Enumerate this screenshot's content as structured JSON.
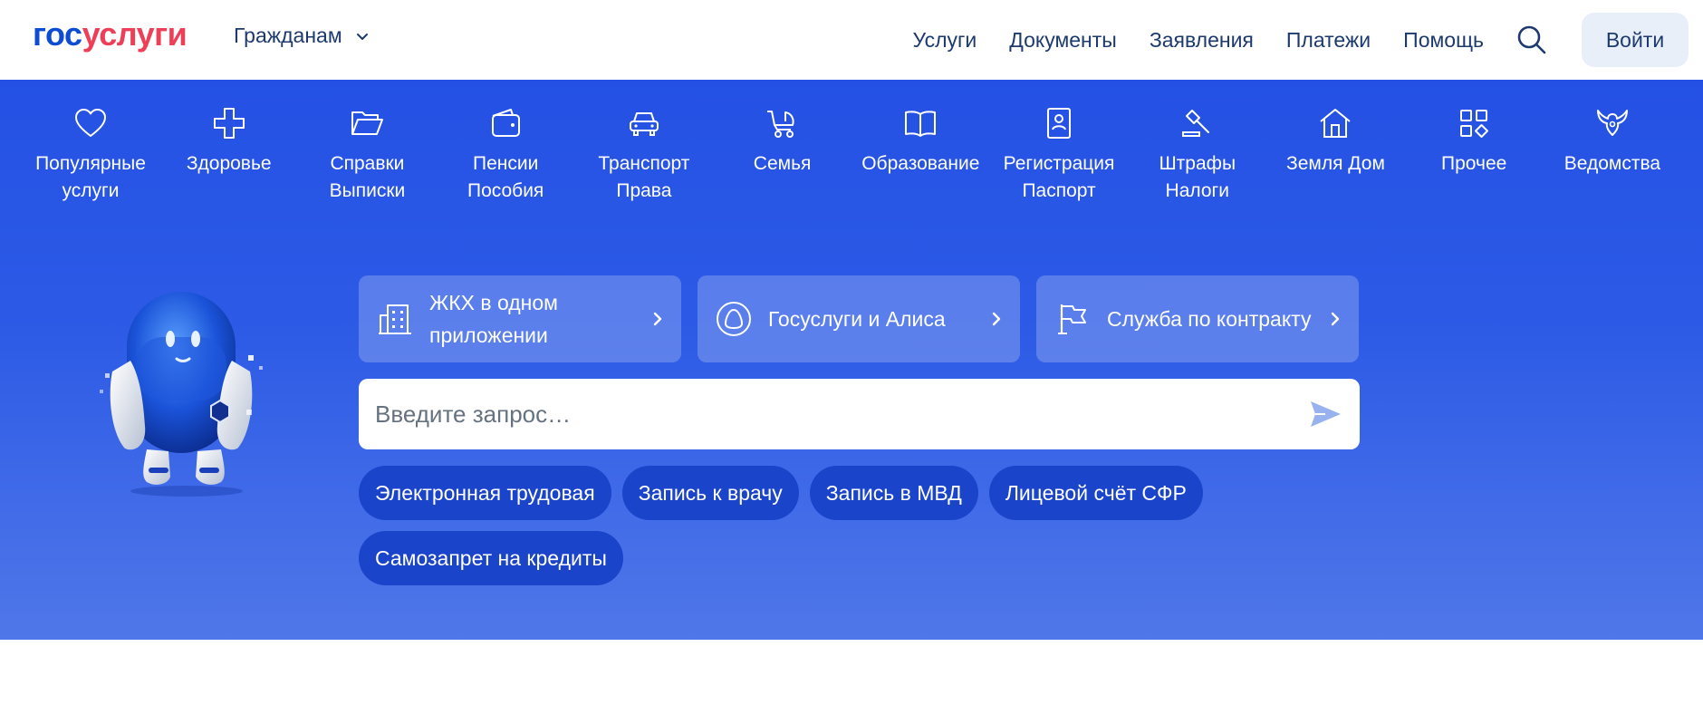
{
  "header": {
    "logo_part1": "гос",
    "logo_part2": "услуги",
    "audience": "Гражданам",
    "nav": [
      "Услуги",
      "Документы",
      "Заявления",
      "Платежи",
      "Помощь"
    ],
    "login": "Войти"
  },
  "categories": [
    {
      "label": "Популярные услуги",
      "icon": "heart-icon"
    },
    {
      "label": "Здоровье",
      "icon": "cross-icon"
    },
    {
      "label": "Справки Выписки",
      "icon": "folder-icon"
    },
    {
      "label": "Пенсии Пособия",
      "icon": "wallet-icon"
    },
    {
      "label": "Транспорт Права",
      "icon": "car-icon"
    },
    {
      "label": "Семья",
      "icon": "stroller-icon"
    },
    {
      "label": "Образование",
      "icon": "book-icon"
    },
    {
      "label": "Регистрация Паспорт",
      "icon": "id-card-icon"
    },
    {
      "label": "Штрафы Налоги",
      "icon": "gavel-icon"
    },
    {
      "label": "Земля Дом",
      "icon": "house-icon"
    },
    {
      "label": "Прочее",
      "icon": "grid-icon"
    },
    {
      "label": "Ведомства",
      "icon": "eagle-icon"
    }
  ],
  "quick_links": [
    {
      "label": "ЖКХ в одном приложении",
      "icon": "building-icon"
    },
    {
      "label": "Госуслуги и Алиса",
      "icon": "alice-icon"
    },
    {
      "label": "Служба по контракту",
      "icon": "flag-icon"
    }
  ],
  "search": {
    "placeholder": "Введите запрос…"
  },
  "chips": [
    "Электронная трудовая",
    "Запись к врачу",
    "Запись в МВД",
    "Лицевой счёт СФР",
    "Самозапрет на кредиты"
  ],
  "colors": {
    "brand_blue": "#0d4cd3",
    "brand_red": "#ee3f58",
    "hero_top": "#2451e4",
    "hero_bottom": "#5077e9",
    "chip": "#1a44c9"
  }
}
